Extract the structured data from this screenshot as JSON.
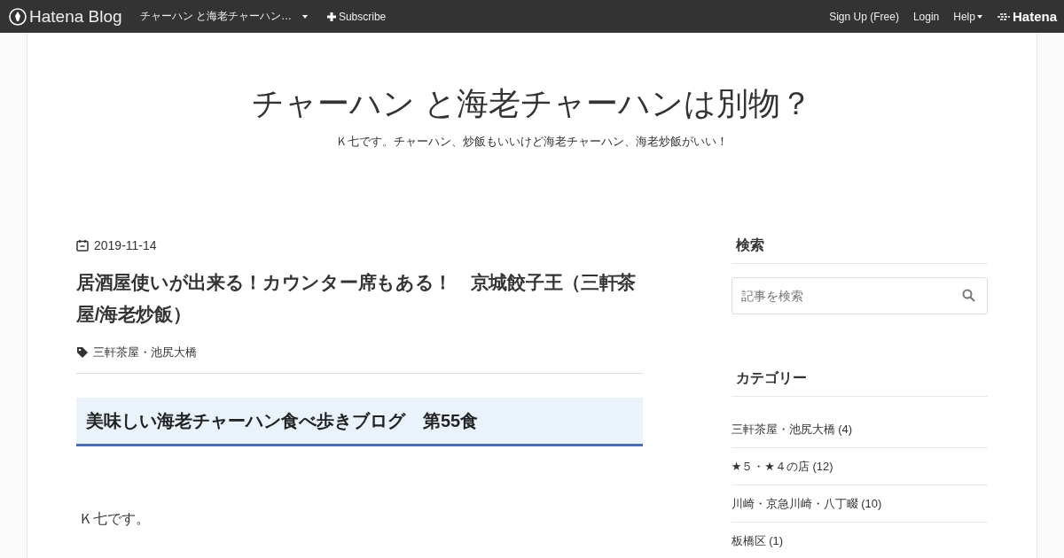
{
  "topbar": {
    "brand": "Hatena Blog",
    "blog_menu": "チャーハン と海老チャーハン…",
    "subscribe": "Subscribe",
    "links": [
      "Sign Up (Free)",
      "Login"
    ],
    "help": "Help",
    "logo": "Hatena"
  },
  "header": {
    "title": "チャーハン と海老チャーハンは別物？",
    "tagline": "Ｋ七です。チャーハン、炒飯もいいけど海老チャーハン、海老炒飯がいい！"
  },
  "entry": {
    "date": "2019-11-14",
    "title": "居酒屋使いが出来る！カウンター席もある！　京城餃子王（三軒茶屋/海老炒飯）",
    "tags": [
      "三軒茶屋・池尻大橋"
    ],
    "heading": "美味しい海老チャーハン食べ歩きブログ　第55食",
    "paragraph": "Ｋ七です。"
  },
  "sidebar": {
    "search": {
      "title": "検索",
      "placeholder": "記事を検索"
    },
    "categories": {
      "title": "カテゴリー",
      "items": [
        "三軒茶屋・池尻大橋 (4)",
        "★５・★４の店 (12)",
        "川崎・京急川崎・八丁畷 (10)",
        "板橋区 (1)"
      ]
    }
  }
}
